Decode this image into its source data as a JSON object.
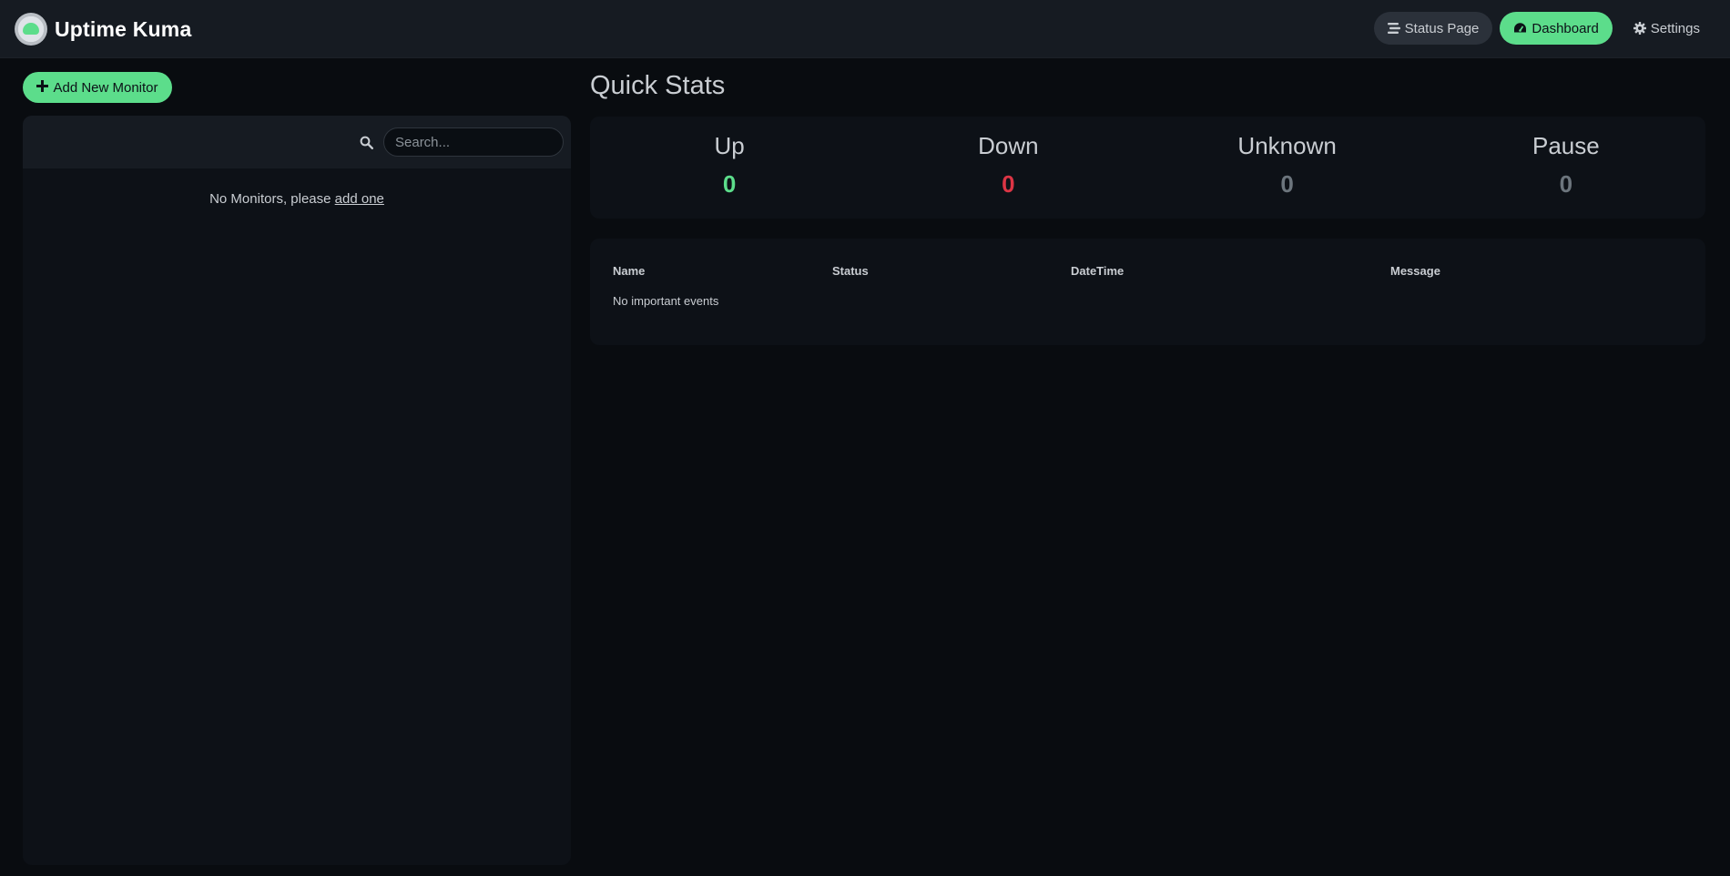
{
  "brand": {
    "title": "Uptime Kuma"
  },
  "nav": {
    "status_page": "Status Page",
    "dashboard": "Dashboard",
    "settings": "Settings"
  },
  "sidebar": {
    "add_button": "Add New Monitor",
    "search_placeholder": "Search...",
    "empty_text": "No Monitors, please ",
    "empty_link": "add one"
  },
  "quick_stats": {
    "title": "Quick Stats",
    "items": [
      {
        "label": "Up",
        "value": "0"
      },
      {
        "label": "Down",
        "value": "0"
      },
      {
        "label": "Unknown",
        "value": "0"
      },
      {
        "label": "Pause",
        "value": "0"
      }
    ]
  },
  "events": {
    "columns": [
      "Name",
      "Status",
      "DateTime",
      "Message"
    ],
    "empty_text": "No important events"
  },
  "colors": {
    "accent": "#5cdd8b",
    "down": "#dc3545",
    "muted": "#6c757d",
    "background": "#090c10",
    "header": "#161b22"
  },
  "icons": {
    "logo": "uptime-kuma-logo",
    "status_page": "stream-icon",
    "dashboard": "tachometer-icon",
    "settings": "cog-icon",
    "add": "plus-icon",
    "search": "search-icon"
  }
}
